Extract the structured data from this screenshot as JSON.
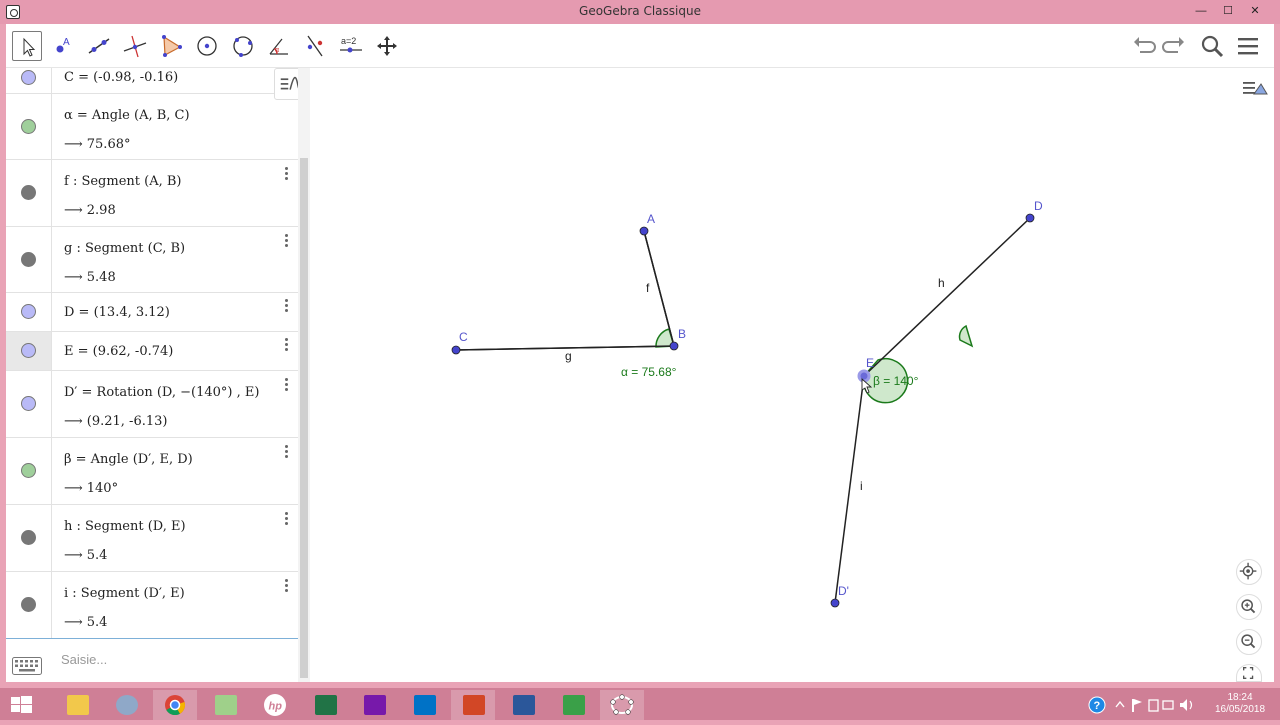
{
  "window": {
    "title": "GeoGebra Classique"
  },
  "algebra": {
    "rows": [
      {
        "def": "C = (-0.98, -0.16)",
        "val": "",
        "color": "#b9baf7"
      },
      {
        "def": "α = Angle (A, B, C)",
        "val": "⟶  75.68°",
        "color": "#9fcf9b"
      },
      {
        "def": "f : Segment (A, B)",
        "val": "⟶  2.98",
        "color": "#777777"
      },
      {
        "def": "g : Segment (C, B)",
        "val": "⟶  5.48",
        "color": "#777777"
      },
      {
        "def": "D = (13.4, 3.12)",
        "val": "",
        "color": "#b9baf7"
      },
      {
        "def": "E = (9.62, -0.74)",
        "val": "",
        "color": "#b9baf7"
      },
      {
        "def": "D′ = Rotation (D, −(140°) , E)",
        "val": "⟶  (9.21, -6.13)",
        "color": "#b9baf7"
      },
      {
        "def": "β = Angle (D′, E, D)",
        "val": "⟶  140°",
        "color": "#9fcf9b"
      },
      {
        "def": "h : Segment (D, E)",
        "val": "⟶  5.4",
        "color": "#777777"
      },
      {
        "def": "i : Segment (D′, E)",
        "val": "⟶  5.4",
        "color": "#777777"
      }
    ],
    "input_placeholder": "Saisie..."
  },
  "graphics": {
    "labels": {
      "A": "A",
      "B": "B",
      "C": "C",
      "D": "D",
      "E": "E",
      "Dp": "D'",
      "f": "f",
      "g": "g",
      "h": "h",
      "i": "i",
      "alpha": "α = 75.68°",
      "beta": "β = 140°"
    },
    "colors": {
      "point": "#4444cc",
      "angle": "#1b7a1b",
      "segment": "#222222"
    }
  },
  "taskbar": {
    "time": "18:24",
    "date": "16/05/2018"
  }
}
